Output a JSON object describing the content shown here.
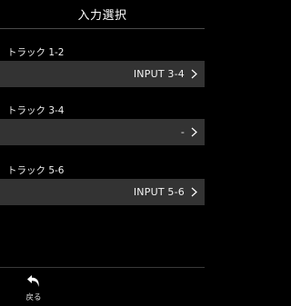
{
  "header": {
    "title": "入力選択"
  },
  "tracks": [
    {
      "label": "トラック 1-2",
      "value": "INPUT 3-4"
    },
    {
      "label": "トラック 3-4",
      "value": "-"
    },
    {
      "label": "トラック 5-6",
      "value": "INPUT 5-6"
    }
  ],
  "footer": {
    "back_label": "戻る",
    "back_icon": "return-arrow-icon"
  },
  "colors": {
    "background": "#000000",
    "row_background": "#333333",
    "text": "#ffffff"
  }
}
